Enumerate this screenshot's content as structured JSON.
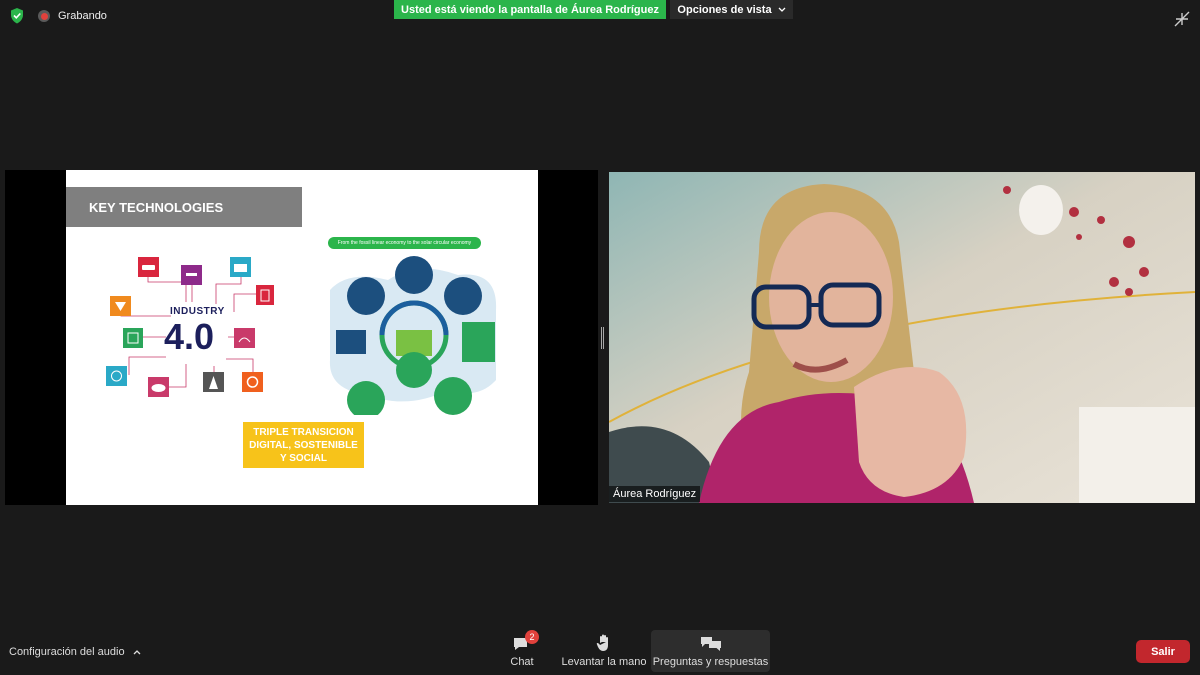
{
  "top_bar": {
    "recording_label": "Grabando",
    "banner_text": "Usted está viendo la pantalla de Áurea Rodríguez",
    "view_options_label": "Opciones de vista"
  },
  "slide": {
    "title": "KEY TECHNOLOGIES",
    "industry_word": "INDUSTRY",
    "industry_number": "4.0",
    "economy_banner": "From the fossil linear economy to the solar circular economy",
    "yellow_box": "TRIPLE TRANSICION DIGITAL, SOSTENIBLE Y SOCIAL"
  },
  "video": {
    "participant_name": "Áurea Rodríguez"
  },
  "bottom_bar": {
    "audio_settings": "Configuración del audio",
    "chat_label": "Chat",
    "chat_badge": "2",
    "raise_hand_label": "Levantar la mano",
    "qa_label": "Preguntas y respuestas",
    "leave_label": "Salir"
  },
  "colors": {
    "banner_green": "#2bb54b",
    "leave_red": "#c2272d",
    "slide_navy": "#1c1f5c",
    "yellow_box": "#f7c31a"
  }
}
